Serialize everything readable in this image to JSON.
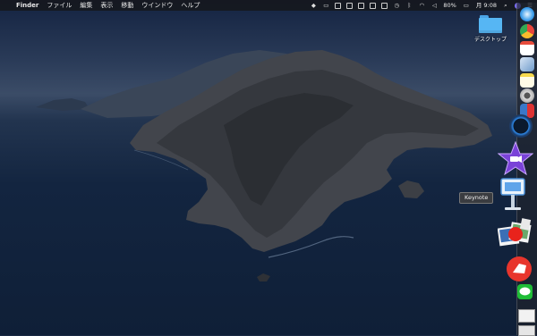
{
  "menubar": {
    "apple_icon": "apple-icon",
    "app_name": "Finder",
    "menus": [
      "ファイル",
      "編集",
      "表示",
      "移動",
      "ウインドウ",
      "ヘルプ"
    ],
    "battery": "80%",
    "clock": "月 9:08"
  },
  "desktop": {
    "folder_label": "デスクトップ"
  },
  "tooltip": {
    "text": "Keynote"
  },
  "dock": {
    "items": [
      "safari",
      "chrome",
      "calendar",
      "preview",
      "notes",
      "photo-booth",
      "sketchbook",
      "activity",
      "quicktime",
      "imovie",
      "keynote",
      "photos",
      "slides",
      "papers",
      "line",
      "finder-window"
    ]
  },
  "colors": {
    "menubar_bg": "#16181e",
    "folder": "#56b6f4",
    "tooltip_bg": "#3a3c40"
  }
}
